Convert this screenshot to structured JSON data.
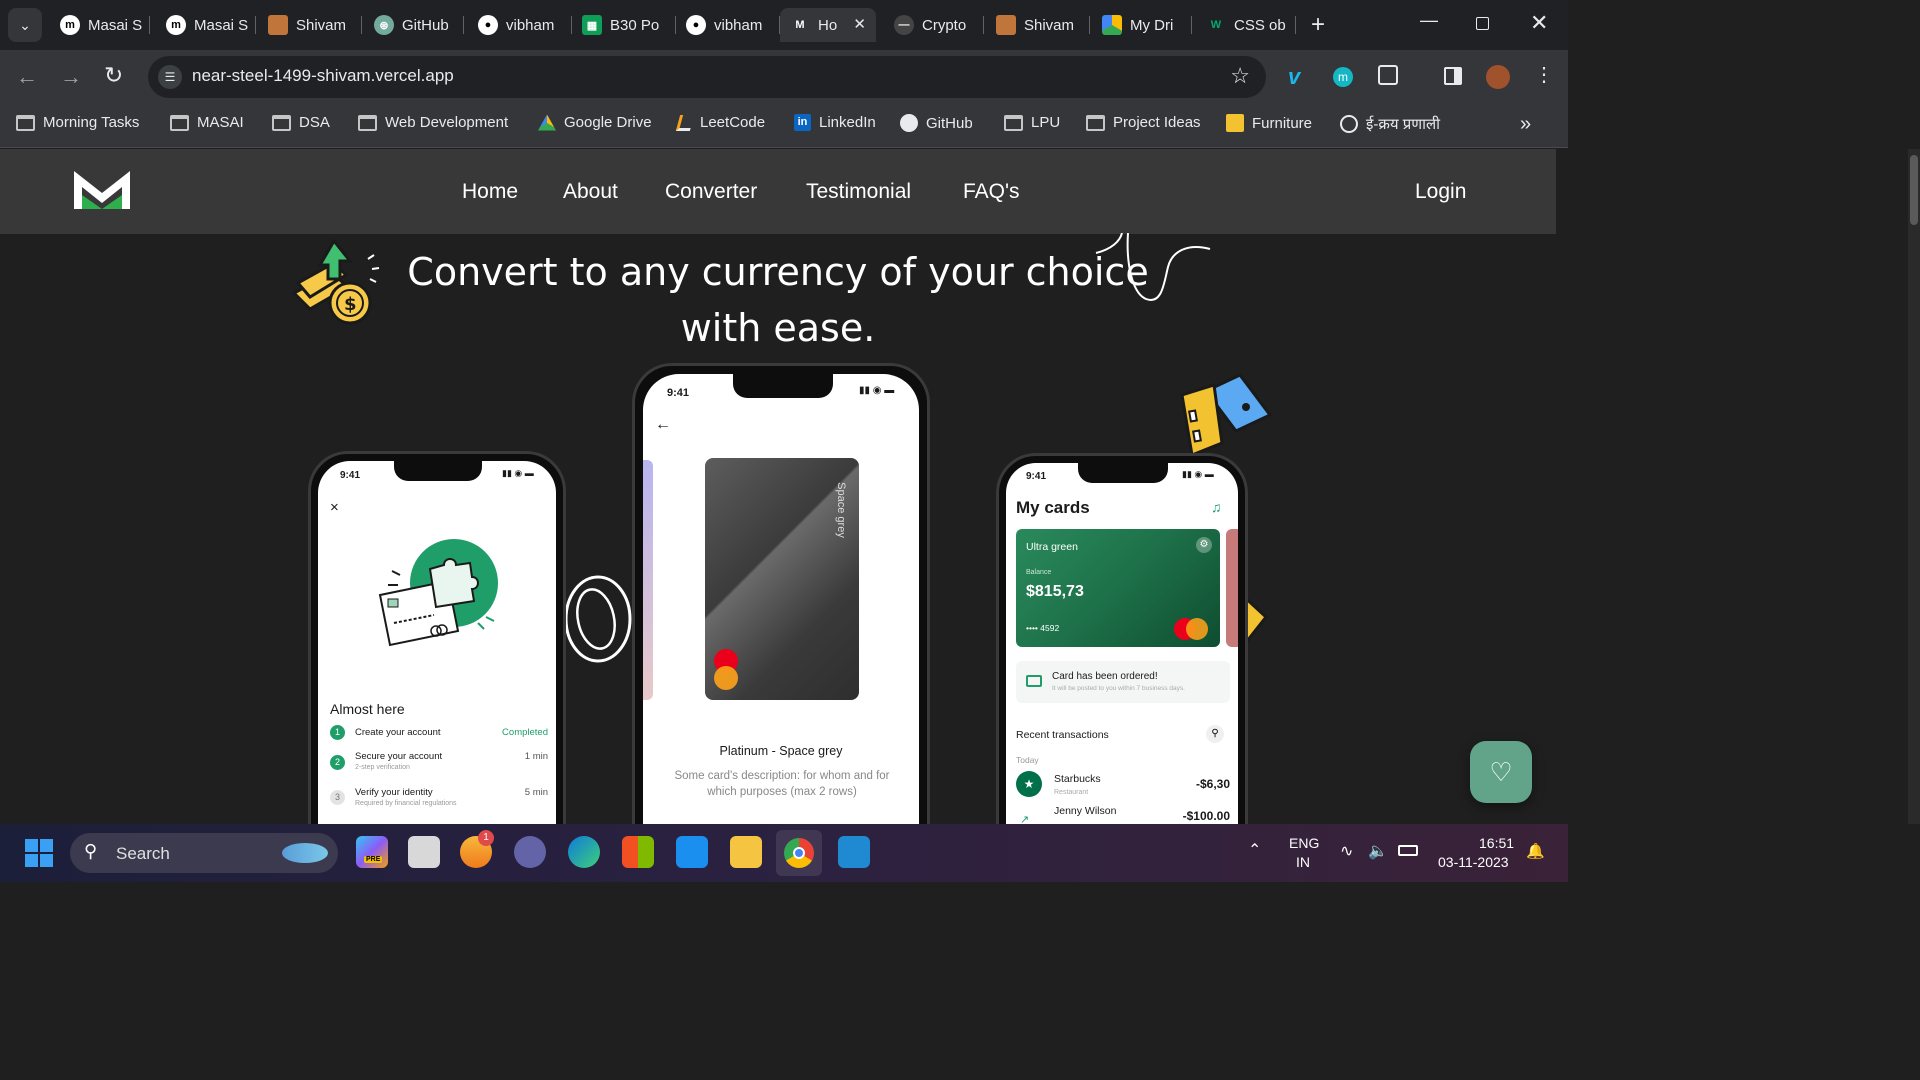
{
  "tabs": [
    {
      "title": "Masai S",
      "icon": "masai-icon"
    },
    {
      "title": "Masai S",
      "icon": "masai-icon"
    },
    {
      "title": "Shivam",
      "icon": "avatar-icon"
    },
    {
      "title": "GitHub",
      "icon": "chatgpt-icon"
    },
    {
      "title": "vibham",
      "icon": "github-icon"
    },
    {
      "title": "B30 Po",
      "icon": "sheets-icon"
    },
    {
      "title": "vibham",
      "icon": "github-icon"
    },
    {
      "title": "Ho",
      "icon": "m-logo-icon",
      "active": true
    },
    {
      "title": "Crypto",
      "icon": "dash-icon"
    },
    {
      "title": "Shivam",
      "icon": "avatar-icon"
    },
    {
      "title": "My Dri",
      "icon": "drive-icon"
    },
    {
      "title": "CSS ob",
      "icon": "w3-icon"
    }
  ],
  "address_bar": {
    "url": "near-steel-1499-shivam.vercel.app"
  },
  "bookmarks": [
    {
      "label": "Morning Tasks",
      "type": "folder"
    },
    {
      "label": "MASAI",
      "type": "folder"
    },
    {
      "label": "DSA",
      "type": "folder"
    },
    {
      "label": "Web Development",
      "type": "folder"
    },
    {
      "label": "Google Drive",
      "type": "drive"
    },
    {
      "label": "LeetCode",
      "type": "leetcode"
    },
    {
      "label": "LinkedIn",
      "type": "linkedin"
    },
    {
      "label": "GitHub",
      "type": "github"
    },
    {
      "label": "LPU",
      "type": "folder"
    },
    {
      "label": "Project Ideas",
      "type": "folder"
    },
    {
      "label": "Furniture",
      "type": "furniture"
    },
    {
      "label": "ई-क्रय प्रणाली",
      "type": "emblem"
    }
  ],
  "nav": {
    "links": [
      "Home",
      "About",
      "Converter",
      "Testimonial",
      "FAQ's"
    ],
    "login": "Login"
  },
  "hero": {
    "title_line1": "Convert to any currency of your choice",
    "title_line2": "with ease."
  },
  "phone_left": {
    "time": "9:41",
    "close": "×",
    "heading": "Almost here",
    "steps": [
      {
        "num": "1",
        "title": "Create your account",
        "sub": "",
        "status": "Completed"
      },
      {
        "num": "2",
        "title": "Secure your account",
        "sub": "2-step verification",
        "status": "1 min"
      },
      {
        "num": "3",
        "title": "Verify your identity",
        "sub": "Required by financial regulations",
        "status": "5 min"
      }
    ]
  },
  "phone_center": {
    "time": "9:41",
    "back": "←",
    "card_side_text": "Space grey",
    "card_title": "Platinum - Space grey",
    "card_desc": "Some card's description: for whom and for which purposes (max 2 rows)"
  },
  "phone_right": {
    "time": "9:41",
    "title": "My cards",
    "card_name": "Ultra green",
    "balance_label": "Balance",
    "balance": "$815,73",
    "card_number": "•••• 4592",
    "notice_title": "Card has been ordered!",
    "notice_sub": "It will be posted to you within 7 business days.",
    "section": "Recent transactions",
    "day": "Today",
    "transactions": [
      {
        "name": "Starbucks",
        "category": "Restaurant",
        "amount": "-$6,30"
      },
      {
        "name": "Jenny Wilson",
        "category": "",
        "amount": "-$100.00"
      }
    ]
  },
  "taskbar": {
    "search": "Search",
    "lang_top": "ENG",
    "lang_bottom": "IN",
    "time": "16:51",
    "date": "03-11-2023",
    "badge": "1",
    "copilot_badge": "PRE"
  },
  "colors": {
    "accent_green": "#1f9e6a",
    "dark_bg": "#1f1f1f",
    "nav_bg": "#383838"
  }
}
